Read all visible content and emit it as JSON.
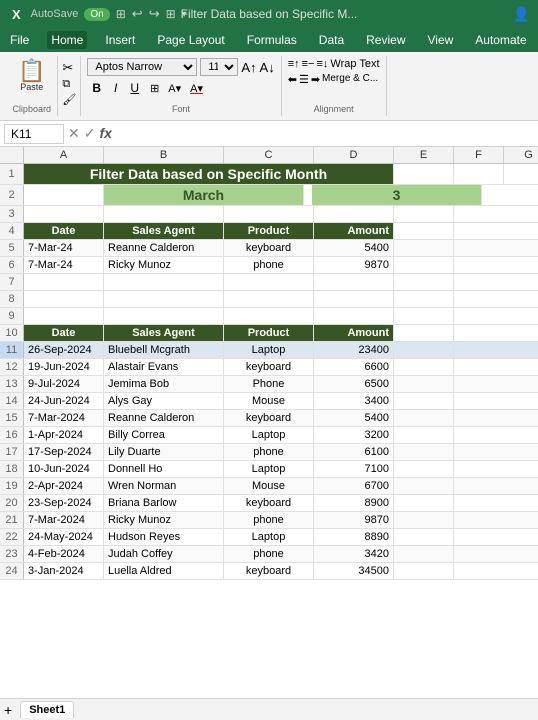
{
  "titleBar": {
    "app": "X",
    "autosave": "AutoSave",
    "autosaveState": "On",
    "title": "Filter Data based on Specific M...",
    "undoIcon": "↩",
    "redoIcon": "↪"
  },
  "menuBar": {
    "items": [
      "File",
      "Home",
      "Insert",
      "Page Layout",
      "Formulas",
      "Data",
      "Review",
      "View",
      "Automate"
    ],
    "active": "Home"
  },
  "ribbon": {
    "clipboard": {
      "paste": "Paste",
      "label": "Clipboard"
    },
    "font": {
      "family": "Aptos Narrow",
      "size": "11",
      "bold": "B",
      "italic": "I",
      "underline": "U",
      "label": "Font"
    },
    "alignment": {
      "wrapText": "Wrap Text",
      "mergeCenter": "Merge & C...",
      "label": "Alignment"
    }
  },
  "formulaBar": {
    "cellRef": "K11",
    "cancelIcon": "✕",
    "confirmIcon": "✓",
    "functionIcon": "fx",
    "value": ""
  },
  "columnHeaders": [
    "A",
    "B",
    "C",
    "D",
    "E",
    "F",
    "G"
  ],
  "spreadsheet": {
    "rows": [
      {
        "num": "1",
        "cells": [
          {
            "span": "title",
            "text": "Filter Data based on Specific Month",
            "style": "merged-title"
          }
        ]
      },
      {
        "num": "2",
        "cells": [
          {
            "text": "",
            "style": "a"
          },
          {
            "text": "March",
            "style": "march"
          },
          {
            "text": "",
            "style": "c"
          },
          {
            "text": "3",
            "style": "num3"
          }
        ]
      },
      {
        "num": "3",
        "cells": []
      },
      {
        "num": "4",
        "cells": [
          {
            "text": "Date",
            "style": "header"
          },
          {
            "text": "Sales Agent",
            "style": "header"
          },
          {
            "text": "Product",
            "style": "header"
          },
          {
            "text": "Amount",
            "style": "header"
          }
        ]
      },
      {
        "num": "5",
        "cells": [
          {
            "text": "7-Mar-24"
          },
          {
            "text": "Reanne Calderon"
          },
          {
            "text": "keyboard",
            "center": true
          },
          {
            "text": "5400",
            "right": true
          }
        ]
      },
      {
        "num": "6",
        "cells": [
          {
            "text": "7-Mar-24"
          },
          {
            "text": "Ricky Munoz"
          },
          {
            "text": "phone",
            "center": true
          },
          {
            "text": "9870",
            "right": true
          }
        ]
      },
      {
        "num": "7",
        "cells": []
      },
      {
        "num": "8",
        "cells": []
      },
      {
        "num": "9",
        "cells": []
      },
      {
        "num": "10",
        "cells": [
          {
            "text": "Date",
            "style": "header"
          },
          {
            "text": "Sales Agent",
            "style": "header"
          },
          {
            "text": "Product",
            "style": "header"
          },
          {
            "text": "Amount",
            "style": "header"
          }
        ]
      },
      {
        "num": "11",
        "cells": [
          {
            "text": "26-Sep-2024"
          },
          {
            "text": "Bluebell Mcgrath"
          },
          {
            "text": "Laptop",
            "center": true
          },
          {
            "text": "23400",
            "right": true
          }
        ]
      },
      {
        "num": "12",
        "cells": [
          {
            "text": "19-Jun-2024"
          },
          {
            "text": "Alastair Evans"
          },
          {
            "text": "keyboard",
            "center": true
          },
          {
            "text": "6600",
            "right": true
          }
        ]
      },
      {
        "num": "13",
        "cells": [
          {
            "text": "9-Jul-2024"
          },
          {
            "text": "Jemima Bob"
          },
          {
            "text": "Phone",
            "center": true
          },
          {
            "text": "6500",
            "right": true
          }
        ]
      },
      {
        "num": "14",
        "cells": [
          {
            "text": "24-Jun-2024"
          },
          {
            "text": "Alys Gay"
          },
          {
            "text": "Mouse",
            "center": true
          },
          {
            "text": "3400",
            "right": true
          }
        ]
      },
      {
        "num": "15",
        "cells": [
          {
            "text": "7-Mar-2024"
          },
          {
            "text": "Reanne Calderon"
          },
          {
            "text": "keyboard",
            "center": true
          },
          {
            "text": "5400",
            "right": true
          }
        ]
      },
      {
        "num": "16",
        "cells": [
          {
            "text": "1-Apr-2024"
          },
          {
            "text": "Billy Correa"
          },
          {
            "text": "Laptop",
            "center": true
          },
          {
            "text": "3200",
            "right": true
          }
        ]
      },
      {
        "num": "17",
        "cells": [
          {
            "text": "17-Sep-2024"
          },
          {
            "text": "Lily Duarte"
          },
          {
            "text": "phone",
            "center": true
          },
          {
            "text": "6100",
            "right": true
          }
        ]
      },
      {
        "num": "18",
        "cells": [
          {
            "text": "10-Jun-2024"
          },
          {
            "text": "Donnell Ho"
          },
          {
            "text": "Laptop",
            "center": true
          },
          {
            "text": "7100",
            "right": true
          }
        ]
      },
      {
        "num": "19",
        "cells": [
          {
            "text": "2-Apr-2024"
          },
          {
            "text": "Wren Norman"
          },
          {
            "text": "Mouse",
            "center": true
          },
          {
            "text": "6700",
            "right": true
          }
        ]
      },
      {
        "num": "20",
        "cells": [
          {
            "text": "23-Sep-2024"
          },
          {
            "text": "Briana Barlow"
          },
          {
            "text": "keyboard",
            "center": true
          },
          {
            "text": "8900",
            "right": true
          }
        ]
      },
      {
        "num": "21",
        "cells": [
          {
            "text": "7-Mar-2024"
          },
          {
            "text": "Ricky Munoz"
          },
          {
            "text": "phone",
            "center": true
          },
          {
            "text": "9870",
            "right": true
          }
        ]
      },
      {
        "num": "22",
        "cells": [
          {
            "text": "24-May-2024"
          },
          {
            "text": "Hudson Reyes"
          },
          {
            "text": "Laptop",
            "center": true
          },
          {
            "text": "8890",
            "right": true
          }
        ]
      },
      {
        "num": "23",
        "cells": [
          {
            "text": "4-Feb-2024"
          },
          {
            "text": "Judah Coffey"
          },
          {
            "text": "phone",
            "center": true
          },
          {
            "text": "3420",
            "right": true
          }
        ]
      },
      {
        "num": "24",
        "cells": [
          {
            "text": "3-Jan-2024"
          },
          {
            "text": "Luella Aldred"
          },
          {
            "text": "keyboard",
            "center": true
          },
          {
            "text": "34500",
            "right": true
          }
        ]
      }
    ]
  },
  "sheetTabs": {
    "tabs": [
      "Sheet1"
    ],
    "active": "Sheet1"
  }
}
